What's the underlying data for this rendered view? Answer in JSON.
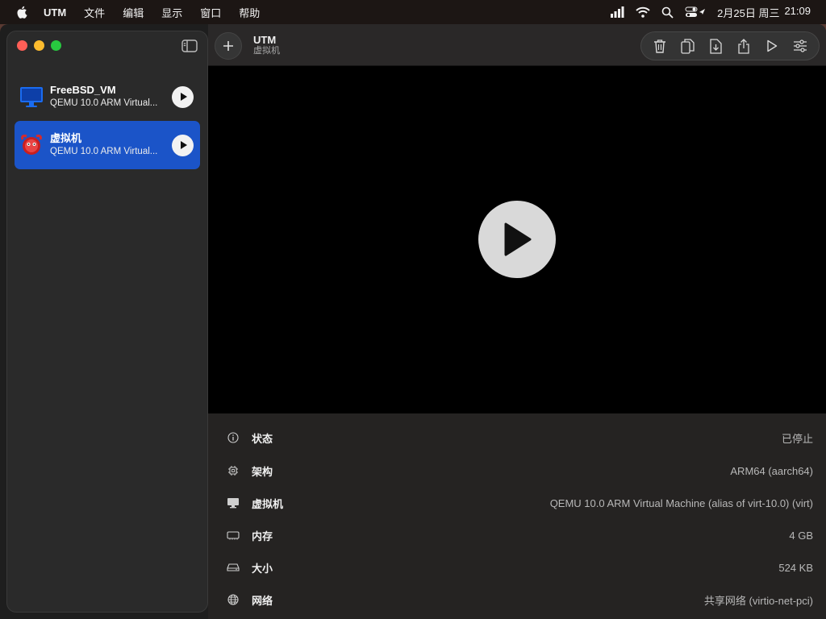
{
  "menubar": {
    "app_name": "UTM",
    "items": [
      "文件",
      "编辑",
      "显示",
      "窗口",
      "帮助"
    ],
    "date": "2月25日 周三",
    "time": "21:09"
  },
  "window": {
    "title": "UTM",
    "subtitle": "虚拟机"
  },
  "sidebar": {
    "vms": [
      {
        "name": "FreeBSD_VM",
        "subtitle": "QEMU 10.0 ARM Virtual...",
        "icon": "monitor-icon",
        "selected": false
      },
      {
        "name": "虚拟机",
        "subtitle": "QEMU 10.0 ARM Virtual...",
        "icon": "freebsd-daemon-icon",
        "selected": true
      }
    ]
  },
  "toolbar": {
    "actions": [
      "delete-icon",
      "clone-icon",
      "export-icon",
      "share-icon",
      "run-icon",
      "settings-icon"
    ]
  },
  "details": {
    "rows": [
      {
        "label": "状态",
        "value": "已停止",
        "icon": "info-icon"
      },
      {
        "label": "架构",
        "value": "ARM64 (aarch64)",
        "icon": "cpu-icon"
      },
      {
        "label": "虚拟机",
        "value": "QEMU 10.0 ARM Virtual Machine (alias of virt-10.0) (virt)",
        "icon": "display-icon"
      },
      {
        "label": "内存",
        "value": "4 GB",
        "icon": "memory-icon"
      },
      {
        "label": "大小",
        "value": "524 KB",
        "icon": "drive-icon"
      },
      {
        "label": "网络",
        "value": "共享网络 (virtio-net-pci)",
        "icon": "globe-icon"
      }
    ]
  },
  "colors": {
    "selection": "#1b54c8",
    "close": "#ff5f57",
    "minimize": "#febc2e",
    "zoom": "#28c840"
  }
}
